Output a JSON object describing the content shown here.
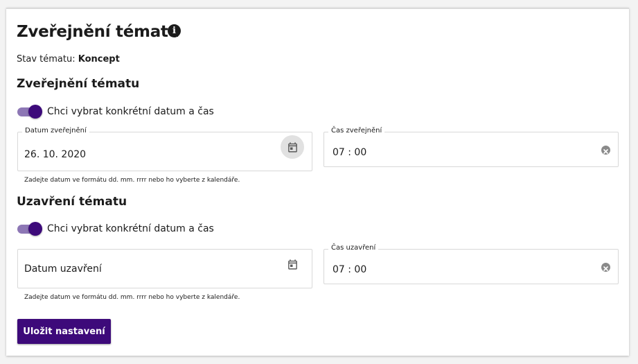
{
  "header": {
    "title": "Zveřejnění tématu",
    "info_icon": "info-icon"
  },
  "status": {
    "label": "Stav tématu:",
    "value": "Koncept"
  },
  "publish": {
    "heading": "Zveřejnění tématu",
    "toggle_label": "Chci vybrat konkrétní datum a čas",
    "toggle_on": true,
    "date_label": "Datum zveřejnění",
    "date_value": "26. 10. 2020",
    "date_hint": "Zadejte datum ve formátu dd. mm. rrrr nebo ho vyberte z kalendáře.",
    "time_label": "Čas zveřejnění",
    "time_value": "07 : 00"
  },
  "close": {
    "heading": "Uzavření tématu",
    "toggle_label": "Chci vybrat konkrétní datum a čas",
    "toggle_on": true,
    "date_placeholder": "Datum uzavření",
    "date_hint": "Zadejte datum ve formátu dd. mm. rrrr nebo ho vyberte z kalendáře.",
    "time_label": "Čas uzavření",
    "time_value": "07 : 00"
  },
  "actions": {
    "save_label": "Uložit nastavení"
  },
  "colors": {
    "accent": "#3d0a7a",
    "toggle_track": "#8d77b5",
    "field_border": "#d8d8d8"
  }
}
